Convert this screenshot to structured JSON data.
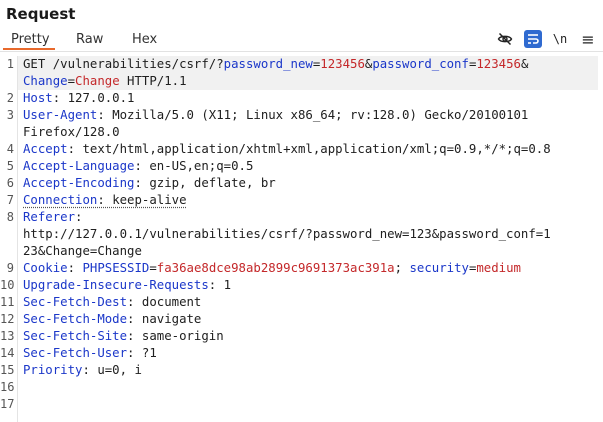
{
  "panel": {
    "title": "Request"
  },
  "tabs": [
    {
      "label": "Pretty",
      "active": true
    },
    {
      "label": "Raw",
      "active": false
    },
    {
      "label": "Hex",
      "active": false
    }
  ],
  "toolbar": {
    "icons": [
      "eye-slash-icon",
      "wrap-lines-icon",
      "newline-toggle-icon",
      "menu-icon"
    ],
    "newline_label": "\\n",
    "menu_label": "≡",
    "accent_color": "#e8692c",
    "active_button_color": "#2f6ad0"
  },
  "line_numbers": [
    "1",
    "2",
    "3",
    "4",
    "5",
    "6",
    "7",
    "8",
    "9",
    "10",
    "11",
    "12",
    "13",
    "14",
    "15",
    "16",
    "17"
  ],
  "request": {
    "line1": {
      "method": "GET",
      "path": " /vulnerabilities/csrf/?",
      "p1_name": "password_new",
      "eq": "=",
      "p1_value": "123456",
      "amp": "&",
      "p2_name": "password_conf",
      "p2_value": "123456",
      "p3_name": "Change",
      "p3_value": "Change",
      "protocol": " HTTP/1.1"
    },
    "host": {
      "name": "Host",
      "value": ": 127.0.0.1"
    },
    "user_agent": {
      "name": "User-Agent",
      "value": ": Mozilla/5.0 (X11; Linux x86_64; rv:128.0) Gecko/20100101",
      "value_cont": "Firefox/128.0"
    },
    "accept": {
      "name": "Accept",
      "value": ": text/html,application/xhtml+xml,application/xml;q=0.9,*/*;q=0.8"
    },
    "accept_language": {
      "name": "Accept-Language",
      "value": ": en-US,en;q=0.5"
    },
    "accept_encoding": {
      "name": "Accept-Encoding",
      "value": ": gzip, deflate, br"
    },
    "connection": {
      "name": "Connection",
      "value": ": keep-alive"
    },
    "referer": {
      "name": "Referer",
      "value_l1": ":",
      "value_l2": "http://127.0.0.1/vulnerabilities/csrf/?password_new=123&password_conf=1",
      "value_l3": "23&Change=Change"
    },
    "cookie": {
      "name": "Cookie",
      "sep": ": ",
      "c1_name": "PHPSESSID",
      "c1_value": "fa36ae8dce98ab2899c9691373ac391a",
      "semi": "; ",
      "c2_name": "security",
      "c2_value": "medium"
    },
    "upgrade": {
      "name": "Upgrade-Insecure-Requests",
      "value": ": 1"
    },
    "sec_fetch_dest": {
      "name": "Sec-Fetch-Dest",
      "value": ": document"
    },
    "sec_fetch_mode": {
      "name": "Sec-Fetch-Mode",
      "value": ": navigate"
    },
    "sec_fetch_site": {
      "name": "Sec-Fetch-Site",
      "value": ": same-origin"
    },
    "sec_fetch_user": {
      "name": "Sec-Fetch-User",
      "value": ": ?1"
    },
    "priority": {
      "name": "Priority",
      "value": ": u=0, i"
    }
  }
}
